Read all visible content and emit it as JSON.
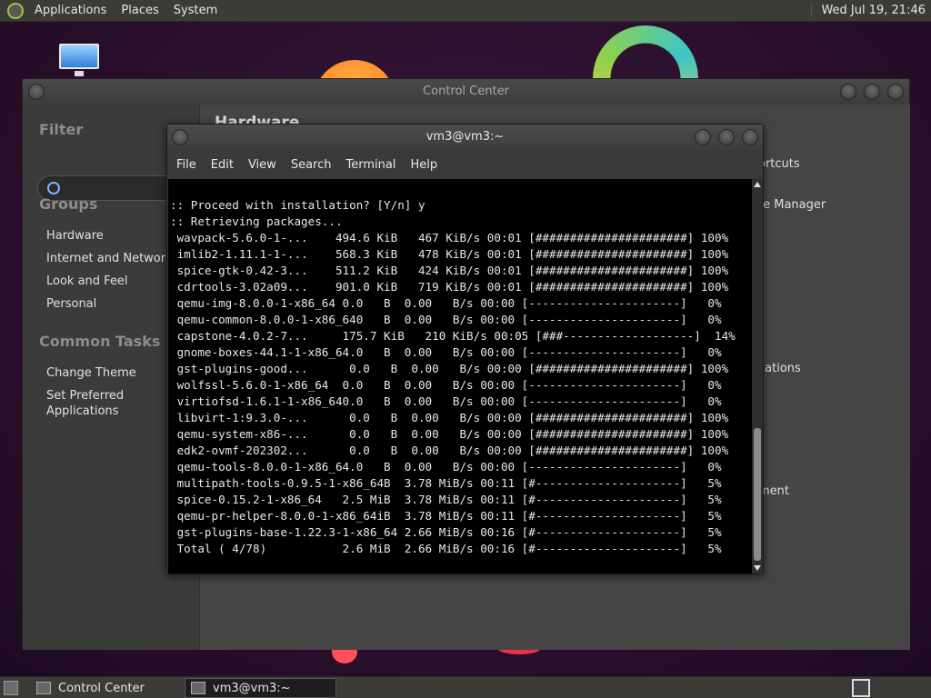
{
  "top_panel": {
    "menus": [
      "Applications",
      "Places",
      "System"
    ],
    "clock": "Wed Jul 19, 21:46"
  },
  "control_center": {
    "title": "Control Center",
    "filter_label": "Filter",
    "groups_label": "Groups",
    "groups": [
      "Hardware",
      "Internet and Network",
      "Look and Feel",
      "Personal"
    ],
    "common_tasks_label": "Common Tasks",
    "tasks": [
      "Change Theme",
      "Set Preferred\nApplications"
    ],
    "main_title": "Hardware",
    "visible_fragments": [
      "ortcuts",
      "te Manager",
      "cations",
      "ment"
    ]
  },
  "terminal": {
    "title": "vm3@vm3:~",
    "menu": [
      "File",
      "Edit",
      "View",
      "Search",
      "Terminal",
      "Help"
    ],
    "lines": [
      ":: Proceed with installation? [Y/n] y",
      ":: Retrieving packages...",
      " wavpack-5.6.0-1-...    494.6 KiB   467 KiB/s 00:01 [######################] 100%",
      " imlib2-1.11.1-1-...    568.3 KiB   478 KiB/s 00:01 [######################] 100%",
      " spice-gtk-0.42-3...    511.2 KiB   424 KiB/s 00:01 [######################] 100%",
      " cdrtools-3.02a09...    901.0 KiB   719 KiB/s 00:01 [######################] 100%",
      " qemu-img-8.0.0-1-x86_64 0.0   B  0.00   B/s 00:00 [----------------------]   0%",
      " qemu-common-8.0.0-1-x86_640   B  0.00   B/s 00:00 [----------------------]   0%",
      " capstone-4.0.2-7...     175.7 KiB   210 KiB/s 00:05 [###-------------------]  14%",
      " gnome-boxes-44.1-1-x86_64.0   B  0.00   B/s 00:00 [----------------------]   0%",
      " gst-plugins-good...      0.0   B  0.00   B/s 00:00 [######################] 100%",
      " wolfssl-5.6.0-1-x86_64  0.0   B  0.00   B/s 00:00 [----------------------]   0%",
      " virtiofsd-1.6.1-1-x86_640.0   B  0.00   B/s 00:00 [----------------------]   0%",
      " libvirt-1:9.3.0-...      0.0   B  0.00   B/s 00:00 [######################] 100%",
      " qemu-system-x86-...      0.0   B  0.00   B/s 00:00 [######################] 100%",
      " edk2-ovmf-202302...      0.0   B  0.00   B/s 00:00 [######################] 100%",
      " qemu-tools-8.0.0-1-x86_64.0   B  0.00   B/s 00:00 [----------------------]   0%",
      " multipath-tools-0.9.5-1-x86_64B  3.78 MiB/s 00:11 [#---------------------]   5%",
      " spice-0.15.2-1-x86_64   2.5 MiB  3.78 MiB/s 00:11 [#---------------------]   5%",
      " qemu-pr-helper-8.0.0-1-x86_64iB  3.78 MiB/s 00:11 [#---------------------]   5%",
      " gst-plugins-base-1.22.3-1-x86_64 2.66 MiB/s 00:16 [#---------------------]   5%",
      " Total ( 4/78)           2.6 MiB  2.66 MiB/s 00:16 [#---------------------]   5%"
    ]
  },
  "bottom_panel": {
    "tasks": [
      "Control Center",
      "vm3@vm3:~"
    ]
  }
}
